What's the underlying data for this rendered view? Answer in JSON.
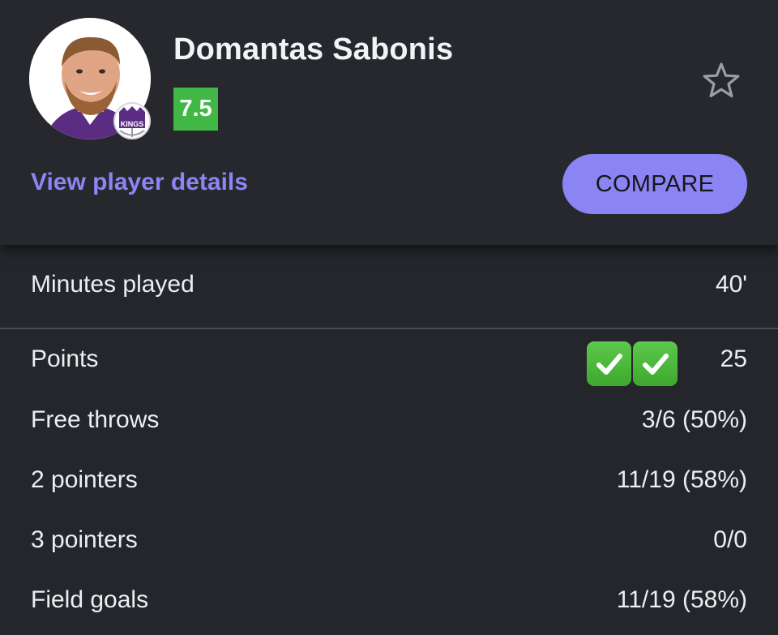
{
  "player": {
    "name": "Domantas Sabonis",
    "rating": "7.5",
    "team_badge_text": "KINGS"
  },
  "actions": {
    "details_link": "View player details",
    "compare_label": "COMPARE"
  },
  "colors": {
    "accent": "#8a84f5",
    "rating_green": "#41b845",
    "background": "#25262b"
  },
  "icons": {
    "favorite": "star-outline-icon",
    "highlight": "check-mark-emoji"
  },
  "stats": {
    "minutes": {
      "label": "Minutes played",
      "value": "40'"
    },
    "points": {
      "label": "Points",
      "value": "25"
    },
    "free_throws": {
      "label": "Free throws",
      "value": "3/6 (50%)"
    },
    "two_pointers": {
      "label": "2 pointers",
      "value": "11/19 (58%)"
    },
    "three_pointers": {
      "label": "3 pointers",
      "value": "0/0"
    },
    "field_goals": {
      "label": "Field goals",
      "value": "11/19 (58%)"
    }
  }
}
